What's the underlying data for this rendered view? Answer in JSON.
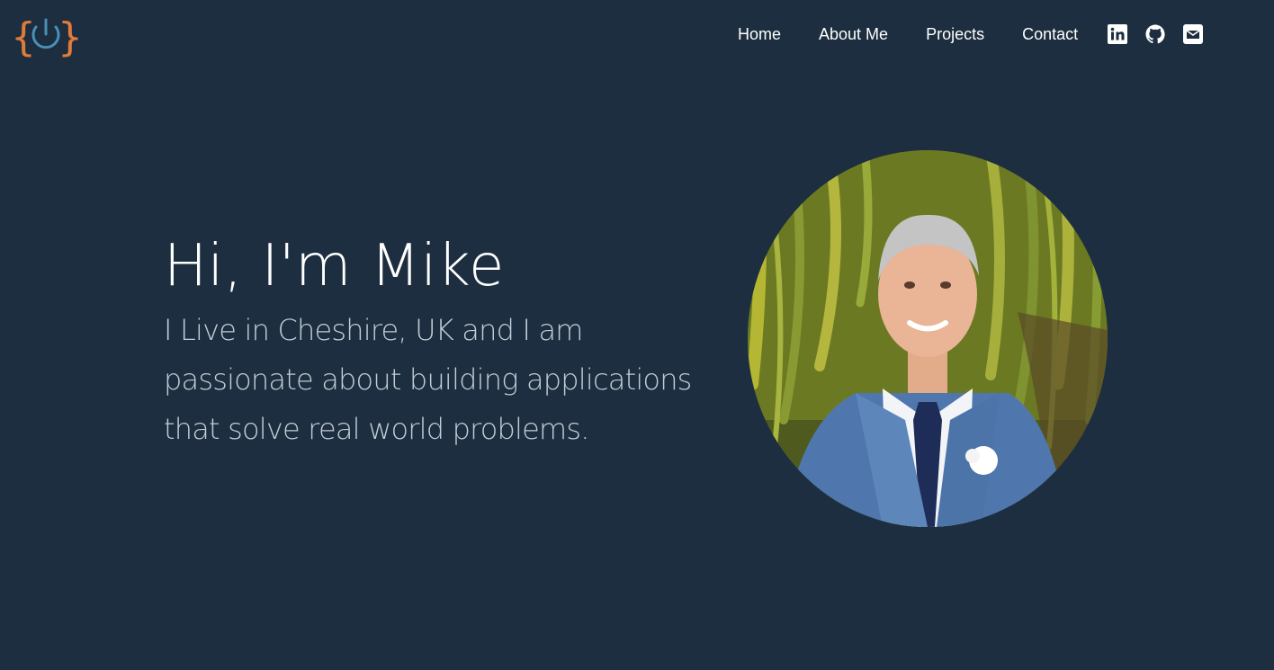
{
  "nav": {
    "items": [
      "Home",
      "About Me",
      "Projects",
      "Contact"
    ]
  },
  "social": {
    "icons": [
      "linkedin-icon",
      "github-icon",
      "envelope-icon"
    ]
  },
  "hero": {
    "title": "Hi, I'm Mike",
    "text": "I Live in Cheshire, UK and I am passionate about building applications that solve real world problems."
  },
  "colors": {
    "background": "#1c2e3f",
    "text": "#ffffff",
    "muted_text": "#c3ccd6",
    "logo_braces": "#e07b39",
    "logo_power": "#4a8fb8"
  }
}
